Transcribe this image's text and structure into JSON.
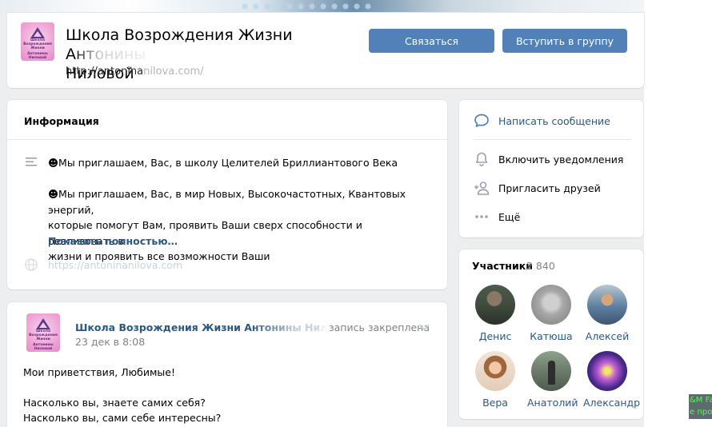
{
  "header": {
    "group_name_visible": "Школа Возрождения Жизни А",
    "group_name_faded": "нтонины",
    "group_name_line2": "Ниловой",
    "url_visible": "http://antonina",
    "url_blurred": "nilova.com/",
    "contact_button": "Связаться",
    "join_button": "Вступить в группу",
    "logo_text": [
      "Школа",
      "Возрождения",
      "Жизни",
      "Антонины",
      "Ниловой"
    ]
  },
  "info": {
    "title": "Информация",
    "paragraph1": "☻Мы приглашаем, Вас, в школу Целителей Бриллиантового Века",
    "paragraph2_line1": "☻Мы приглашаем, Вас, в мир Новых, Высокочастотных, Квантовых энергий,",
    "paragraph2_line2": "которые помогут Вам, проявить Ваши сверх способности и реализовать в",
    "paragraph2_line3": "жизни и проявить все возможности Ваши",
    "show_more": "Показать полностью…",
    "site_url": "https://antoninanilova.com"
  },
  "actions": {
    "items": [
      {
        "label": "Написать сообщение",
        "icon": "message-icon"
      },
      {
        "label": "Включить уведомления",
        "icon": "bell-icon"
      },
      {
        "label": "Пригласить друзей",
        "icon": "add-user-icon"
      },
      {
        "label": "Ещё",
        "icon": "more-icon"
      }
    ]
  },
  "members": {
    "title": "Участники",
    "count": "2 840",
    "list": [
      {
        "name": "Денис"
      },
      {
        "name": "Катюша"
      },
      {
        "name": "Алексей"
      },
      {
        "name": "Вера"
      },
      {
        "name": "Анатолий"
      },
      {
        "name": "Александр"
      }
    ]
  },
  "post": {
    "author_visible": "Школа Возрождения Жизни А",
    "author_faded": "нтонины Ниловой",
    "pinned": "запись закреплена",
    "date": "23 дек в 8:08",
    "line1": "Мои приветствия, Любимые!",
    "line2": "Насколько вы, знаете самих себя?",
    "line3": "Насколько вы, сами себе интересны?"
  },
  "corner_widget": {
    "line1": "&M Fa",
    "line2": "е проц"
  },
  "colors": {
    "accent": "#5181b8",
    "link": "#2a5885",
    "background": "#edeef0"
  }
}
